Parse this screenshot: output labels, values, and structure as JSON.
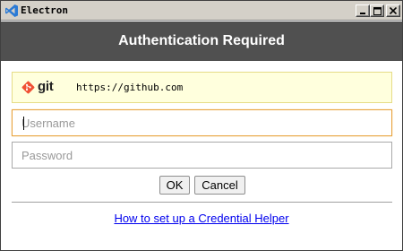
{
  "window": {
    "title": "Electron",
    "minimize_label": "",
    "maximize_label": "",
    "close_label": ""
  },
  "dialog": {
    "heading": "Authentication Required",
    "remote": {
      "brand": "git",
      "url": "https://github.com"
    },
    "username": {
      "placeholder": "Username",
      "value": ""
    },
    "password": {
      "placeholder": "Password",
      "value": ""
    },
    "ok_label": "OK",
    "cancel_label": "Cancel",
    "help_link": "How to set up a Credential Helper"
  },
  "colors": {
    "header_bg": "#505050",
    "remote_bg": "#ffffdd",
    "focus_border": "#e8a33d",
    "git_brand": "#f05033",
    "link": "#0000ee"
  }
}
